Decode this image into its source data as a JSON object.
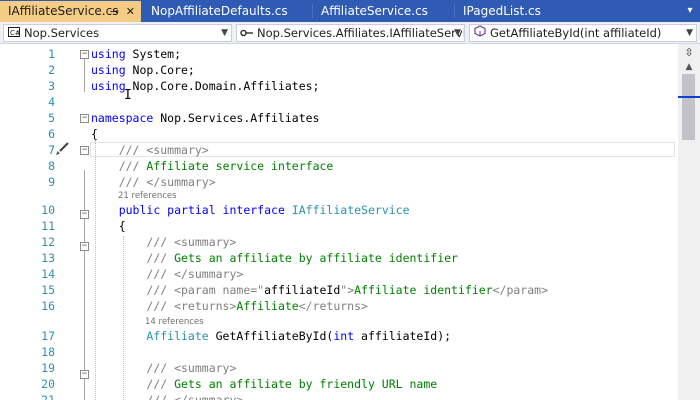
{
  "tabs": [
    {
      "label": "IAffiliateService.cs",
      "active": true,
      "pin_icon": "⊸",
      "close_icon": "✕"
    },
    {
      "label": "NopAffiliateDefaults.cs",
      "active": false
    },
    {
      "label": "AffiliateService.cs",
      "active": false
    },
    {
      "label": "IPagedList.cs",
      "active": false
    }
  ],
  "tab_overflow_icon": "▾",
  "navbar": {
    "project": "Nop.Services",
    "type": "Nop.Services.Affiliates.IAffiliateServic",
    "member": "GetAffiliateById(int affiliateId)"
  },
  "colors": {
    "tab_bar": "#2f5bb4",
    "active_tab": "#f5cc84",
    "keyword": "#0000ff",
    "type": "#2b91af",
    "comment": "#008000",
    "doc_tag": "#808080",
    "line_number": "#2b91af"
  },
  "code_lines": [
    {
      "num": "1",
      "segs": [
        {
          "c": "kw",
          "t": "using"
        },
        {
          "c": "",
          "t": " System;"
        }
      ]
    },
    {
      "num": "2",
      "segs": [
        {
          "c": "kw",
          "t": "using"
        },
        {
          "c": "",
          "t": " Nop.Core;"
        }
      ]
    },
    {
      "num": "3",
      "segs": [
        {
          "c": "kw",
          "t": "using"
        },
        {
          "c": "",
          "t": " Nop.Core.Domain.Affiliates;"
        }
      ]
    },
    {
      "num": "4",
      "segs": []
    },
    {
      "num": "5",
      "segs": [
        {
          "c": "kw",
          "t": "namespace"
        },
        {
          "c": "",
          "t": " Nop.Services.Affiliates"
        }
      ]
    },
    {
      "num": "6",
      "segs": [
        {
          "c": "",
          "t": "{"
        }
      ]
    },
    {
      "num": "7",
      "segs": [
        {
          "c": "",
          "t": "    "
        },
        {
          "c": "dc",
          "t": "/// <summary>"
        }
      ]
    },
    {
      "num": "8",
      "segs": [
        {
          "c": "",
          "t": "    "
        },
        {
          "c": "dc",
          "t": "/// "
        },
        {
          "c": "cm",
          "t": "Affiliate service interface"
        }
      ]
    },
    {
      "num": "9",
      "segs": [
        {
          "c": "",
          "t": "    "
        },
        {
          "c": "dc",
          "t": "/// </summary>"
        }
      ]
    },
    {
      "num": "10",
      "segs": [
        {
          "c": "",
          "t": "    "
        },
        {
          "c": "kw",
          "t": "public partial interface"
        },
        {
          "c": "",
          "t": " "
        },
        {
          "c": "tp",
          "t": "IAffiliateService"
        }
      ]
    },
    {
      "num": "11",
      "segs": [
        {
          "c": "",
          "t": "    {"
        }
      ]
    },
    {
      "num": "12",
      "segs": [
        {
          "c": "",
          "t": "        "
        },
        {
          "c": "dc",
          "t": "/// <summary>"
        }
      ]
    },
    {
      "num": "13",
      "segs": [
        {
          "c": "",
          "t": "        "
        },
        {
          "c": "dc",
          "t": "/// "
        },
        {
          "c": "cm",
          "t": "Gets an affiliate by affiliate identifier"
        }
      ]
    },
    {
      "num": "14",
      "segs": [
        {
          "c": "",
          "t": "        "
        },
        {
          "c": "dc",
          "t": "/// </summary>"
        }
      ]
    },
    {
      "num": "15",
      "segs": [
        {
          "c": "",
          "t": "        "
        },
        {
          "c": "dc",
          "t": "/// <param name=\""
        },
        {
          "c": "",
          "t": "affiliateId"
        },
        {
          "c": "dc",
          "t": "\">"
        },
        {
          "c": "cm",
          "t": "Affiliate identifier"
        },
        {
          "c": "dc",
          "t": "</param>"
        }
      ]
    },
    {
      "num": "16",
      "segs": [
        {
          "c": "",
          "t": "        "
        },
        {
          "c": "dc",
          "t": "/// <returns>"
        },
        {
          "c": "cm",
          "t": "Affiliate"
        },
        {
          "c": "dc",
          "t": "</returns>"
        }
      ]
    },
    {
      "num": "17",
      "segs": [
        {
          "c": "",
          "t": "        "
        },
        {
          "c": "tp",
          "t": "Affiliate"
        },
        {
          "c": "",
          "t": " GetAffiliateById("
        },
        {
          "c": "kw",
          "t": "int"
        },
        {
          "c": "",
          "t": " affiliateId);"
        }
      ]
    },
    {
      "num": "18",
      "segs": []
    },
    {
      "num": "19",
      "segs": [
        {
          "c": "",
          "t": "        "
        },
        {
          "c": "dc",
          "t": "/// <summary>"
        }
      ]
    },
    {
      "num": "20",
      "segs": [
        {
          "c": "",
          "t": "        "
        },
        {
          "c": "dc",
          "t": "/// "
        },
        {
          "c": "cm",
          "t": "Gets an affiliate by friendly URL name"
        }
      ]
    },
    {
      "num": "21",
      "segs": [
        {
          "c": "",
          "t": "        "
        },
        {
          "c": "dc",
          "t": "/// </summary>"
        }
      ]
    }
  ],
  "references": [
    {
      "after_line": "9",
      "label": "21 references"
    },
    {
      "after_line": "16",
      "label": "14 references"
    }
  ]
}
